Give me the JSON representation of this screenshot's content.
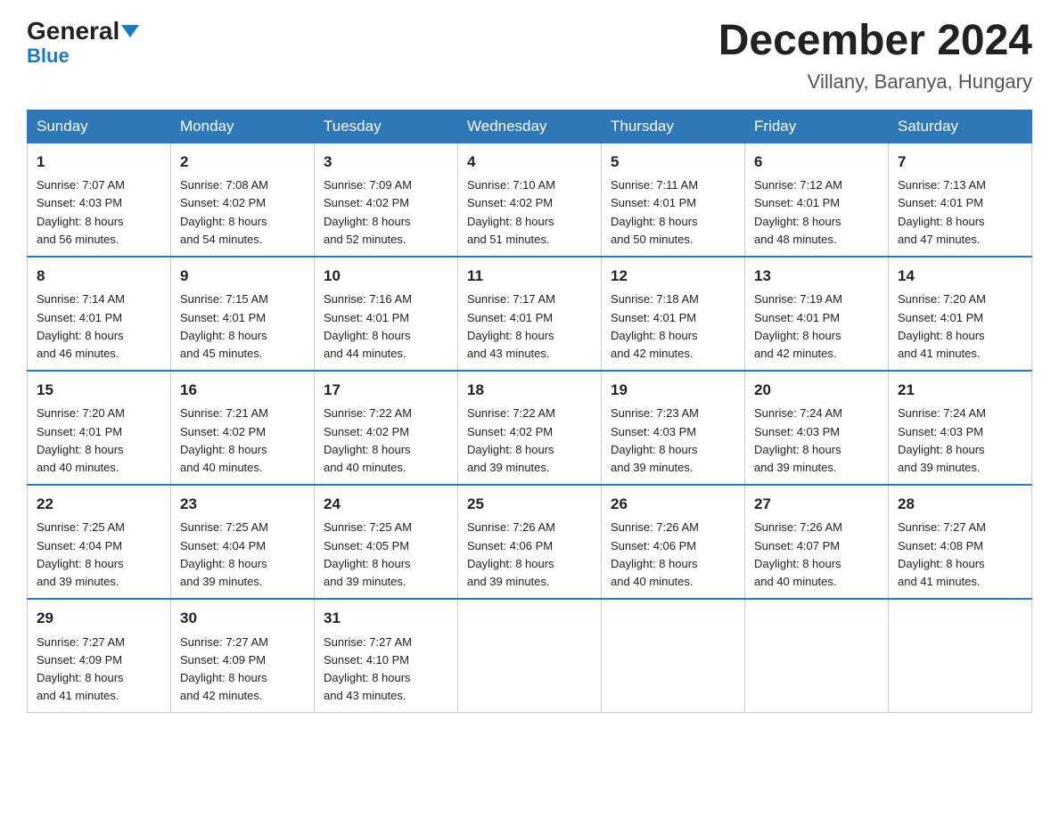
{
  "header": {
    "logo_general": "General",
    "logo_blue": "Blue",
    "month_title": "December 2024",
    "location": "Villany, Baranya, Hungary"
  },
  "days_of_week": [
    "Sunday",
    "Monday",
    "Tuesday",
    "Wednesday",
    "Thursday",
    "Friday",
    "Saturday"
  ],
  "weeks": [
    [
      {
        "day": "1",
        "sunrise": "Sunrise: 7:07 AM",
        "sunset": "Sunset: 4:03 PM",
        "daylight": "Daylight: 8 hours",
        "daylight2": "and 56 minutes."
      },
      {
        "day": "2",
        "sunrise": "Sunrise: 7:08 AM",
        "sunset": "Sunset: 4:02 PM",
        "daylight": "Daylight: 8 hours",
        "daylight2": "and 54 minutes."
      },
      {
        "day": "3",
        "sunrise": "Sunrise: 7:09 AM",
        "sunset": "Sunset: 4:02 PM",
        "daylight": "Daylight: 8 hours",
        "daylight2": "and 52 minutes."
      },
      {
        "day": "4",
        "sunrise": "Sunrise: 7:10 AM",
        "sunset": "Sunset: 4:02 PM",
        "daylight": "Daylight: 8 hours",
        "daylight2": "and 51 minutes."
      },
      {
        "day": "5",
        "sunrise": "Sunrise: 7:11 AM",
        "sunset": "Sunset: 4:01 PM",
        "daylight": "Daylight: 8 hours",
        "daylight2": "and 50 minutes."
      },
      {
        "day": "6",
        "sunrise": "Sunrise: 7:12 AM",
        "sunset": "Sunset: 4:01 PM",
        "daylight": "Daylight: 8 hours",
        "daylight2": "and 48 minutes."
      },
      {
        "day": "7",
        "sunrise": "Sunrise: 7:13 AM",
        "sunset": "Sunset: 4:01 PM",
        "daylight": "Daylight: 8 hours",
        "daylight2": "and 47 minutes."
      }
    ],
    [
      {
        "day": "8",
        "sunrise": "Sunrise: 7:14 AM",
        "sunset": "Sunset: 4:01 PM",
        "daylight": "Daylight: 8 hours",
        "daylight2": "and 46 minutes."
      },
      {
        "day": "9",
        "sunrise": "Sunrise: 7:15 AM",
        "sunset": "Sunset: 4:01 PM",
        "daylight": "Daylight: 8 hours",
        "daylight2": "and 45 minutes."
      },
      {
        "day": "10",
        "sunrise": "Sunrise: 7:16 AM",
        "sunset": "Sunset: 4:01 PM",
        "daylight": "Daylight: 8 hours",
        "daylight2": "and 44 minutes."
      },
      {
        "day": "11",
        "sunrise": "Sunrise: 7:17 AM",
        "sunset": "Sunset: 4:01 PM",
        "daylight": "Daylight: 8 hours",
        "daylight2": "and 43 minutes."
      },
      {
        "day": "12",
        "sunrise": "Sunrise: 7:18 AM",
        "sunset": "Sunset: 4:01 PM",
        "daylight": "Daylight: 8 hours",
        "daylight2": "and 42 minutes."
      },
      {
        "day": "13",
        "sunrise": "Sunrise: 7:19 AM",
        "sunset": "Sunset: 4:01 PM",
        "daylight": "Daylight: 8 hours",
        "daylight2": "and 42 minutes."
      },
      {
        "day": "14",
        "sunrise": "Sunrise: 7:20 AM",
        "sunset": "Sunset: 4:01 PM",
        "daylight": "Daylight: 8 hours",
        "daylight2": "and 41 minutes."
      }
    ],
    [
      {
        "day": "15",
        "sunrise": "Sunrise: 7:20 AM",
        "sunset": "Sunset: 4:01 PM",
        "daylight": "Daylight: 8 hours",
        "daylight2": "and 40 minutes."
      },
      {
        "day": "16",
        "sunrise": "Sunrise: 7:21 AM",
        "sunset": "Sunset: 4:02 PM",
        "daylight": "Daylight: 8 hours",
        "daylight2": "and 40 minutes."
      },
      {
        "day": "17",
        "sunrise": "Sunrise: 7:22 AM",
        "sunset": "Sunset: 4:02 PM",
        "daylight": "Daylight: 8 hours",
        "daylight2": "and 40 minutes."
      },
      {
        "day": "18",
        "sunrise": "Sunrise: 7:22 AM",
        "sunset": "Sunset: 4:02 PM",
        "daylight": "Daylight: 8 hours",
        "daylight2": "and 39 minutes."
      },
      {
        "day": "19",
        "sunrise": "Sunrise: 7:23 AM",
        "sunset": "Sunset: 4:03 PM",
        "daylight": "Daylight: 8 hours",
        "daylight2": "and 39 minutes."
      },
      {
        "day": "20",
        "sunrise": "Sunrise: 7:24 AM",
        "sunset": "Sunset: 4:03 PM",
        "daylight": "Daylight: 8 hours",
        "daylight2": "and 39 minutes."
      },
      {
        "day": "21",
        "sunrise": "Sunrise: 7:24 AM",
        "sunset": "Sunset: 4:03 PM",
        "daylight": "Daylight: 8 hours",
        "daylight2": "and 39 minutes."
      }
    ],
    [
      {
        "day": "22",
        "sunrise": "Sunrise: 7:25 AM",
        "sunset": "Sunset: 4:04 PM",
        "daylight": "Daylight: 8 hours",
        "daylight2": "and 39 minutes."
      },
      {
        "day": "23",
        "sunrise": "Sunrise: 7:25 AM",
        "sunset": "Sunset: 4:04 PM",
        "daylight": "Daylight: 8 hours",
        "daylight2": "and 39 minutes."
      },
      {
        "day": "24",
        "sunrise": "Sunrise: 7:25 AM",
        "sunset": "Sunset: 4:05 PM",
        "daylight": "Daylight: 8 hours",
        "daylight2": "and 39 minutes."
      },
      {
        "day": "25",
        "sunrise": "Sunrise: 7:26 AM",
        "sunset": "Sunset: 4:06 PM",
        "daylight": "Daylight: 8 hours",
        "daylight2": "and 39 minutes."
      },
      {
        "day": "26",
        "sunrise": "Sunrise: 7:26 AM",
        "sunset": "Sunset: 4:06 PM",
        "daylight": "Daylight: 8 hours",
        "daylight2": "and 40 minutes."
      },
      {
        "day": "27",
        "sunrise": "Sunrise: 7:26 AM",
        "sunset": "Sunset: 4:07 PM",
        "daylight": "Daylight: 8 hours",
        "daylight2": "and 40 minutes."
      },
      {
        "day": "28",
        "sunrise": "Sunrise: 7:27 AM",
        "sunset": "Sunset: 4:08 PM",
        "daylight": "Daylight: 8 hours",
        "daylight2": "and 41 minutes."
      }
    ],
    [
      {
        "day": "29",
        "sunrise": "Sunrise: 7:27 AM",
        "sunset": "Sunset: 4:09 PM",
        "daylight": "Daylight: 8 hours",
        "daylight2": "and 41 minutes."
      },
      {
        "day": "30",
        "sunrise": "Sunrise: 7:27 AM",
        "sunset": "Sunset: 4:09 PM",
        "daylight": "Daylight: 8 hours",
        "daylight2": "and 42 minutes."
      },
      {
        "day": "31",
        "sunrise": "Sunrise: 7:27 AM",
        "sunset": "Sunset: 4:10 PM",
        "daylight": "Daylight: 8 hours",
        "daylight2": "and 43 minutes."
      },
      null,
      null,
      null,
      null
    ]
  ]
}
